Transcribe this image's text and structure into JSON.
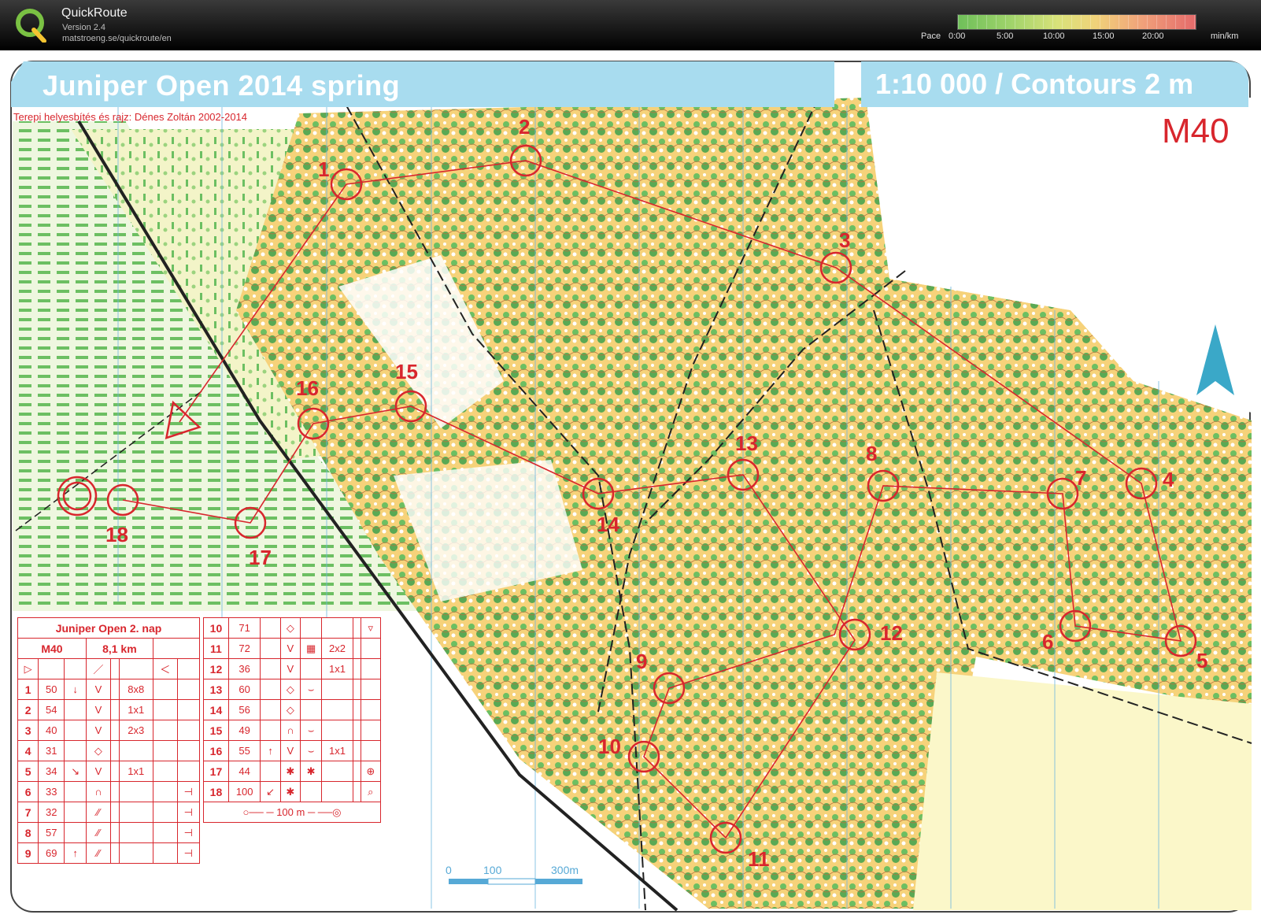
{
  "app": {
    "title": "QuickRoute",
    "version": "Version 2.4",
    "url": "matstroeng.se/quickroute/en"
  },
  "pace_scale": {
    "label": "Pace",
    "ticks": [
      "0:00",
      "5:00",
      "10:00",
      "15:00",
      "20:00"
    ],
    "unit": "min/km"
  },
  "map": {
    "title": "Juniper Open 2014 spring",
    "scale": "1:10 000 / Contours 2 m",
    "credit": "Terepi helyesbítés és rajz: Dénes Zoltán 2002-2014",
    "class": "M40",
    "controls": [
      "1",
      "2",
      "3",
      "4",
      "5",
      "6",
      "7",
      "8",
      "9",
      "10",
      "11",
      "12",
      "13",
      "14",
      "15",
      "16",
      "17",
      "18"
    ],
    "scalebar": [
      "0",
      "100",
      "300m"
    ]
  },
  "descriptions": {
    "event": "Juniper Open 2. nap",
    "class": "M40",
    "length": "8,1 km",
    "rows_left": [
      {
        "n": "1",
        "code": "50",
        "a": "↓",
        "b": "V",
        "c": "8x8"
      },
      {
        "n": "2",
        "code": "54",
        "a": "",
        "b": "V",
        "c": "1x1"
      },
      {
        "n": "3",
        "code": "40",
        "a": "",
        "b": "V",
        "c": "2x3"
      },
      {
        "n": "4",
        "code": "31",
        "a": "",
        "b": "◇",
        "c": ""
      },
      {
        "n": "5",
        "code": "34",
        "a": "↘",
        "b": "V",
        "c": "1x1"
      },
      {
        "n": "6",
        "code": "33",
        "a": "",
        "b": "∩",
        "c": ""
      },
      {
        "n": "7",
        "code": "32",
        "a": "",
        "b": "⁄⁄",
        "c": ""
      },
      {
        "n": "8",
        "code": "57",
        "a": "",
        "b": "⁄⁄",
        "c": ""
      },
      {
        "n": "9",
        "code": "69",
        "a": "↑",
        "b": "⁄⁄",
        "c": ""
      }
    ],
    "rows_right": [
      {
        "n": "10",
        "code": "71",
        "a": "",
        "b": "◇",
        "c": ""
      },
      {
        "n": "11",
        "code": "72",
        "a": "",
        "b": "V",
        "c": "2x2"
      },
      {
        "n": "12",
        "code": "36",
        "a": "",
        "b": "V",
        "c": "1x1"
      },
      {
        "n": "13",
        "code": "60",
        "a": "",
        "b": "◇",
        "c": ""
      },
      {
        "n": "14",
        "code": "56",
        "a": "",
        "b": "◇",
        "c": ""
      },
      {
        "n": "15",
        "code": "49",
        "a": "",
        "b": "∩",
        "c": ""
      },
      {
        "n": "16",
        "code": "55",
        "a": "↑",
        "b": "V",
        "c": "1x1"
      },
      {
        "n": "17",
        "code": "44",
        "a": "",
        "b": "✱",
        "c": ""
      },
      {
        "n": "18",
        "code": "100",
        "a": "↙",
        "b": "✱",
        "c": ""
      }
    ],
    "finish": "100 m"
  },
  "colors": {
    "course": "#d8262d",
    "banner": "#a8dcef",
    "forest": "#6cbf62",
    "open": "#f6d27a",
    "north_arrow": "#3aa8c8",
    "grid": "#6fb7e0"
  }
}
